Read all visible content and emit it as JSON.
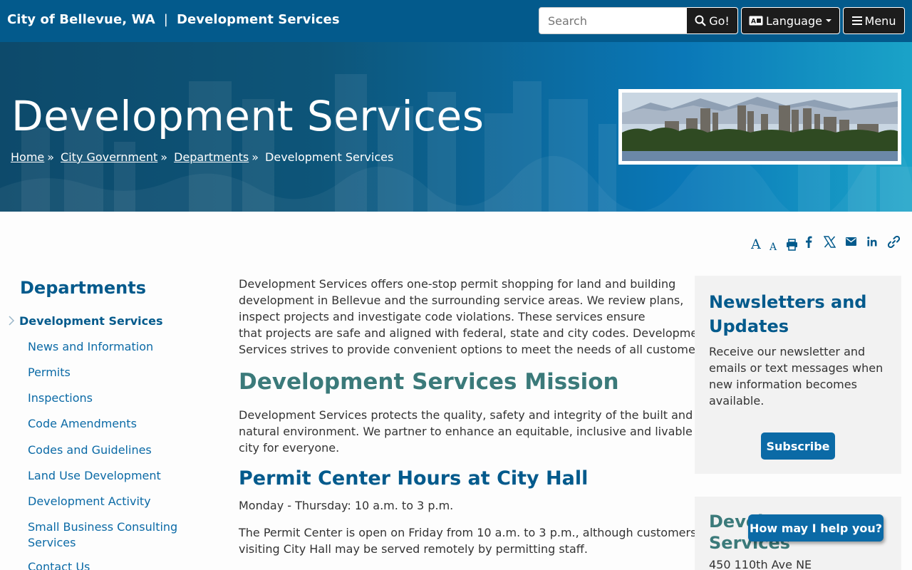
{
  "header": {
    "city": "City of Bellevue, WA",
    "separator": "|",
    "department": "Development Services",
    "search_placeholder": "Search",
    "go_label": "Go!",
    "language_label": "Language",
    "menu_label": "Menu"
  },
  "hero": {
    "title": "Development Services",
    "breadcrumbs": [
      "Home",
      "City Government",
      "Departments",
      "Development Services"
    ],
    "crumb_sep": "»"
  },
  "tools": [
    "increase-text",
    "decrease-text",
    "print",
    "facebook",
    "x",
    "email",
    "linkedin",
    "copy-link"
  ],
  "sidebar": {
    "title": "Departments",
    "active": "Development Services",
    "items": [
      "News and Information",
      "Permits",
      "Inspections",
      "Code Amendments",
      "Codes and Guidelines",
      "Land Use Development",
      "Development Activity",
      "Small Business Consulting",
      "Services",
      "Contact Us"
    ]
  },
  "main": {
    "intro": [
      "Development Services offers one-stop permit shopping for land and building",
      "development in Bellevue and the surrounding service areas. We review plans,",
      "inspect projects and investigate code violations. These services ensure",
      "that projects are safe and aligned with federal, state and city codes. Development",
      "Services strives to provide convenient options to meet the needs of all customers."
    ],
    "mission_heading": "Development Services Mission",
    "mission": [
      "Development Services protects the quality, safety and integrity of the built and",
      "natural environment. We partner to enhance an equitable, inclusive and livable",
      "city for everyone."
    ],
    "hours_heading": "Permit Center Hours at City Hall",
    "hours": "Monday - Thursday: 10 a.m. to 3 p.m.",
    "friday": [
      "The Permit Center is open on Friday from 10 a.m. to 3 p.m., although customers",
      "visiting City Hall may be served remotely by permitting staff."
    ]
  },
  "newsletter": {
    "heading": [
      "Newsletters and",
      "Updates"
    ],
    "body": [
      "Receive our newsletter and",
      "emails or text messages when",
      "new information becomes",
      "available."
    ],
    "button": "Subscribe"
  },
  "contact": {
    "heading": [
      "Development",
      "Services"
    ],
    "address": "450 110th Ave NE"
  },
  "chat": {
    "label": "How may I help you?"
  },
  "colors": {
    "brand": "#035a8c",
    "link": "#0b6aa6",
    "mission": "#3b7a7a"
  }
}
